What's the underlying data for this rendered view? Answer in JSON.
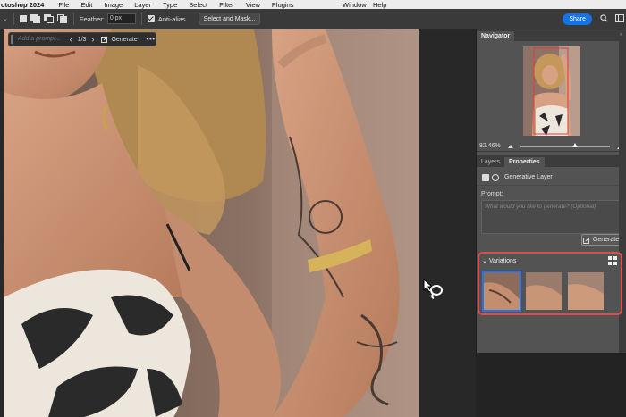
{
  "menubar": {
    "app": "otoshop 2024",
    "items": [
      "File",
      "Edit",
      "Image",
      "Layer",
      "Type",
      "Select",
      "Filter",
      "View",
      "Plugins"
    ],
    "window": "Window",
    "help": "Help"
  },
  "optionsbar": {
    "feather_label": "Feather:",
    "feather_value": "0 px",
    "antialias_label": "Anti-alias",
    "select_mask": "Select and Mask...",
    "share": "Share"
  },
  "contextbar": {
    "prompt_placeholder": "Add a prompt...",
    "counter": "1/3",
    "generate": "Generate"
  },
  "navigator": {
    "tab": "Navigator",
    "zoom": "82.46%"
  },
  "properties": {
    "tabs": [
      "Layers",
      "Properties"
    ],
    "layer_type": "Generative Layer",
    "prompt_label": "Prompt:",
    "prompt_placeholder": "What would you like to generate? (Optional)",
    "generate": "Generate",
    "variations_label": "Variations"
  },
  "colors": {
    "accent": "#1473e6",
    "highlight": "#e04b4b",
    "selected_variation": "#2a72e8"
  }
}
